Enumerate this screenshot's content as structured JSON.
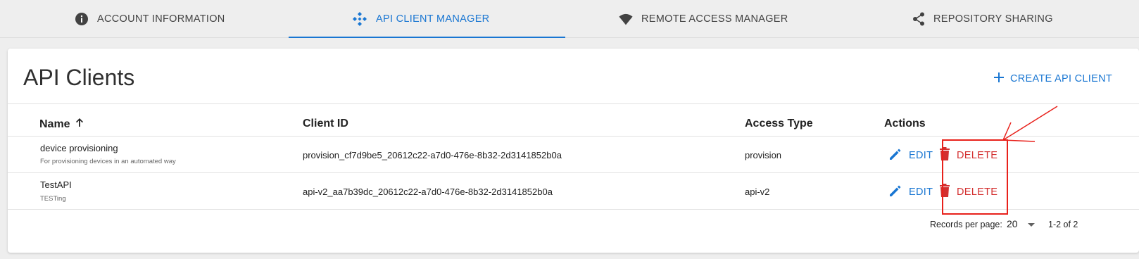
{
  "tabs": [
    {
      "label": "ACCOUNT INFORMATION",
      "icon": "info-icon",
      "active": false
    },
    {
      "label": "API CLIENT MANAGER",
      "icon": "api-icon",
      "active": true
    },
    {
      "label": "REMOTE ACCESS MANAGER",
      "icon": "wifi-icon",
      "active": false
    },
    {
      "label": "REPOSITORY SHARING",
      "icon": "share-icon",
      "active": false
    }
  ],
  "page": {
    "title": "API Clients",
    "create_label": "CREATE API CLIENT"
  },
  "table": {
    "columns": [
      "Name",
      "Client ID",
      "Access Type",
      "Actions"
    ],
    "sort": {
      "column": "Name",
      "direction": "ascending"
    },
    "rows": [
      {
        "name": "device provisioning",
        "description": "For provisioning devices in an automated way",
        "client_id": "provision_cf7d9be5_20612c22-a7d0-476e-8b32-2d3141852b0a",
        "access_type": "provision",
        "edit_label": "EDIT",
        "delete_label": "DELETE"
      },
      {
        "name": "TestAPI",
        "description": "TESTing",
        "client_id": "api-v2_aa7b39dc_20612c22-a7d0-476e-8b32-2d3141852b0a",
        "access_type": "api-v2",
        "edit_label": "EDIT",
        "delete_label": "DELETE"
      }
    ]
  },
  "pagination": {
    "records_label": "Records per page:",
    "per_page": "20",
    "range": "1-2 of 2"
  },
  "colors": {
    "accent": "#1976d2",
    "danger": "#d32f2f",
    "annotation": "#e8211b"
  }
}
